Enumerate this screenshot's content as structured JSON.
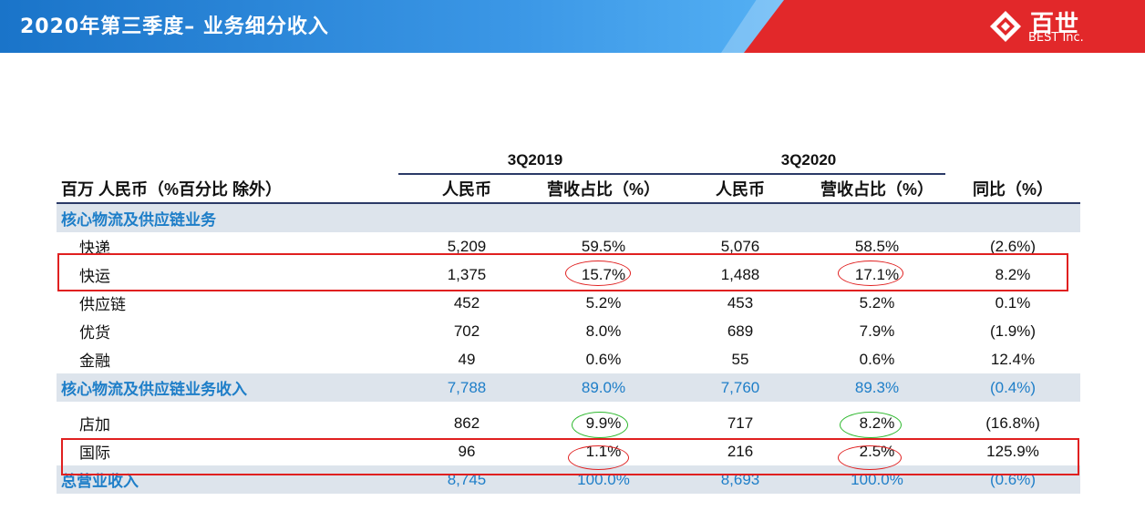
{
  "header": {
    "title": "2020年第三季度– 业务细分收入"
  },
  "logo": {
    "name_cn": "百世",
    "name_en": "BEST Inc.",
    "mark_icon": "best-logo-icon"
  },
  "colors": {
    "header_blue": "#1a74c9",
    "brand_red": "#e2282a",
    "section_blue": "#1e7ec8",
    "section_bg": "#dde4ec",
    "highlight_red": "#e02020",
    "highlight_green": "#2db82d"
  },
  "table": {
    "periods": [
      "3Q2019",
      "3Q2020"
    ],
    "headers": [
      "百万 人民币（%百分比 除外）",
      "人民币",
      "营收占比（%）",
      "人民币",
      "营收占比（%）",
      "同比（%）"
    ],
    "section_label": "核心物流及供应链业务",
    "rows": [
      {
        "label": "快递",
        "rmb_2019": "5,209",
        "pct_2019": "59.5%",
        "rmb_2020": "5,076",
        "pct_2020": "58.5%",
        "yoy": "(2.6%)"
      },
      {
        "label": "快运",
        "rmb_2019": "1,375",
        "pct_2019": "15.7%",
        "rmb_2020": "1,488",
        "pct_2020": "17.1%",
        "yoy": "8.2%"
      },
      {
        "label": "供应链",
        "rmb_2019": "452",
        "pct_2019": "5.2%",
        "rmb_2020": "453",
        "pct_2020": "5.2%",
        "yoy": "0.1%"
      },
      {
        "label": "优货",
        "rmb_2019": "702",
        "pct_2019": "8.0%",
        "rmb_2020": "689",
        "pct_2020": "7.9%",
        "yoy": "(1.9%)"
      },
      {
        "label": "金融",
        "rmb_2019": "49",
        "pct_2019": "0.6%",
        "rmb_2020": "55",
        "pct_2020": "0.6%",
        "yoy": "12.4%"
      }
    ],
    "subtotal": {
      "label": "核心物流及供应链业务收入",
      "rmb_2019": "7,788",
      "pct_2019": "89.0%",
      "rmb_2020": "7,760",
      "pct_2020": "89.3%",
      "yoy": "(0.4%)"
    },
    "other_rows": [
      {
        "label": "店加",
        "rmb_2019": "862",
        "pct_2019": "9.9%",
        "rmb_2020": "717",
        "pct_2020": "8.2%",
        "yoy": "(16.8%)"
      },
      {
        "label": "国际",
        "rmb_2019": "96",
        "pct_2019": "1.1%",
        "rmb_2020": "216",
        "pct_2020": "2.5%",
        "yoy": "125.9%"
      }
    ],
    "total": {
      "label": "总营业收入",
      "rmb_2019": "8,745",
      "pct_2019": "100.0%",
      "rmb_2020": "8,693",
      "pct_2020": "100.0%",
      "yoy": "(0.6%)"
    }
  }
}
